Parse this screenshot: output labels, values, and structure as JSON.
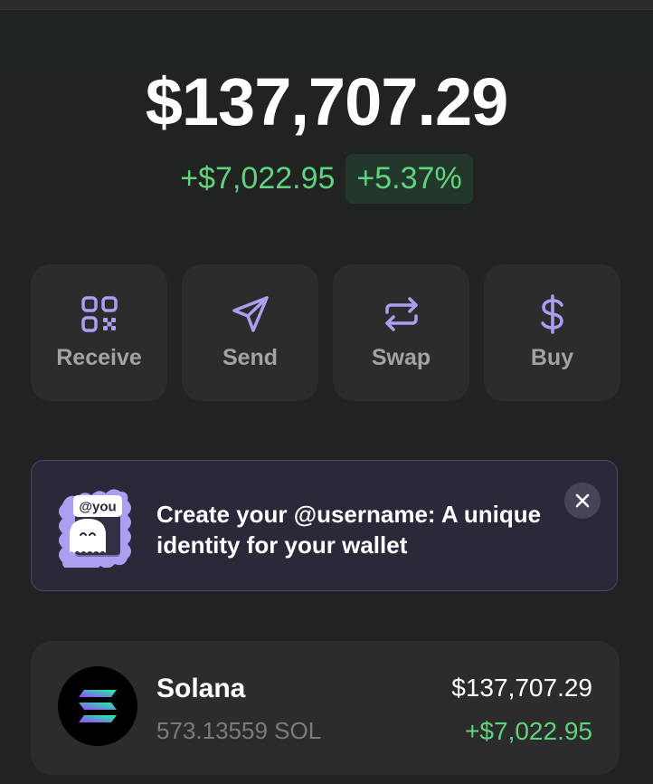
{
  "balance": {
    "total": "$137,707.29",
    "change_abs": "+$7,022.95",
    "change_pct": "+5.37%"
  },
  "actions": [
    {
      "label": "Receive",
      "icon": "qr-code-icon"
    },
    {
      "label": "Send",
      "icon": "send-icon"
    },
    {
      "label": "Swap",
      "icon": "swap-icon"
    },
    {
      "label": "Buy",
      "icon": "dollar-icon"
    }
  ],
  "banner": {
    "tag": "@you",
    "text": "Create your @username: A unique identity for your wallet",
    "close_icon": "close-icon"
  },
  "tokens": [
    {
      "name": "Solana",
      "amount": "573.13559 SOL",
      "value": "$137,707.29",
      "change": "+$7,022.95",
      "icon": "solana-logo-icon"
    }
  ],
  "colors": {
    "accent": "#ab9ff2",
    "positive": "#5fd37d",
    "card": "#2c2c2c",
    "background": "#222222"
  }
}
